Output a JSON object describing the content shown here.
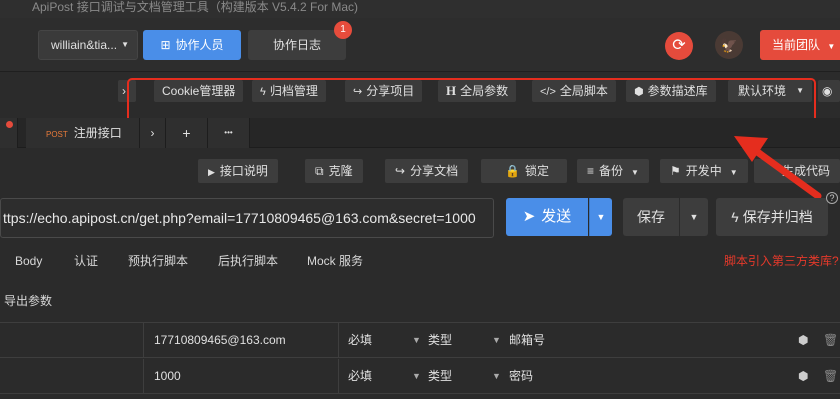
{
  "window": {
    "title": "ApiPost 接口调试与文档管理工具（构建版本 V5.4.2 For Mac)"
  },
  "topbar": {
    "user_select": "williain&tia...",
    "collab_label": "协作人员",
    "log_label": "协作日志",
    "log_badge": "1",
    "team_label": "当前团队"
  },
  "toolbar": {
    "collapse_label": "›",
    "items": [
      {
        "label": "Cookie管理器",
        "icon": ""
      },
      {
        "label": "归档管理",
        "icon": "bolt-icon"
      },
      {
        "label": "分享项目",
        "icon": "share-icon"
      },
      {
        "label": "全局参数",
        "icon": "header-icon"
      },
      {
        "label": "全局脚本",
        "icon": "code-icon"
      },
      {
        "label": "参数描述库",
        "icon": "cube-icon"
      }
    ],
    "env_label": "默认环境"
  },
  "tabs": {
    "active_method": "POST",
    "active_label": "注册接口",
    "add_label": "+",
    "more_label": "•••"
  },
  "actions": {
    "doc_label": "接口说明",
    "clone_label": "克隆",
    "share_doc_label": "分享文档",
    "lock_label": "锁定",
    "backup_label": "备份",
    "dev_label": "开发中",
    "codegen_label": "生成代码"
  },
  "request": {
    "url": "ttps://echo.apipost.cn/get.php?email=17710809465@163.com&secret=1000",
    "send_label": "发送",
    "save_label": "保存",
    "save_archive_label": "保存并归档",
    "help": "?"
  },
  "subtabs": [
    "Body",
    "认证",
    "预执行脚本",
    "后执行脚本",
    "Mock 服务"
  ],
  "lib_link": "脚本引入第三方类库?",
  "export_label": "导出参数",
  "params": [
    {
      "value": "17710809465@163.com",
      "required": "必填",
      "type_label": "类型",
      "desc": "邮箱号"
    },
    {
      "value": "1000",
      "required": "必填",
      "type_label": "类型",
      "desc": "密码"
    }
  ],
  "colors": {
    "accent_blue": "#4a8ee8",
    "accent_red": "#e54b3c",
    "annotation_red": "#e52d1e"
  }
}
